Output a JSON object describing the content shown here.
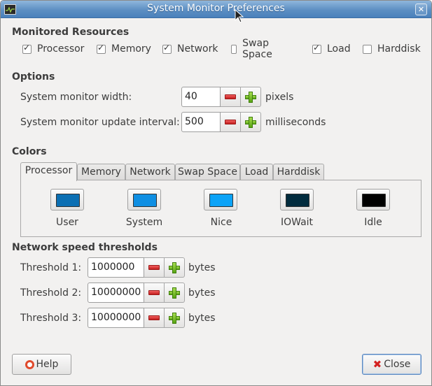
{
  "window": {
    "title": "System Monitor Preferences",
    "close_glyph": "✕"
  },
  "resources": {
    "title": "Monitored Resources",
    "items": [
      {
        "label": "Processor",
        "checked": true
      },
      {
        "label": "Memory",
        "checked": true
      },
      {
        "label": "Network",
        "checked": true
      },
      {
        "label": "Swap Space",
        "checked": false
      },
      {
        "label": "Load",
        "checked": true
      },
      {
        "label": "Harddisk",
        "checked": false
      }
    ]
  },
  "options": {
    "title": "Options",
    "width": {
      "label": "System monitor width:",
      "value": "40",
      "unit": "pixels"
    },
    "interval": {
      "label": "System monitor update interval:",
      "value": "500",
      "unit": "milliseconds"
    }
  },
  "colors": {
    "title": "Colors",
    "tabs": [
      "Processor",
      "Memory",
      "Network",
      "Swap Space",
      "Load",
      "Harddisk"
    ],
    "active_tab": "Processor",
    "swatches": [
      {
        "label": "User",
        "color": "#0b6fb3"
      },
      {
        "label": "System",
        "color": "#0f8fe3"
      },
      {
        "label": "Nice",
        "color": "#0ba3f7"
      },
      {
        "label": "IOWait",
        "color": "#022c3e"
      },
      {
        "label": "Idle",
        "color": "#000000"
      }
    ]
  },
  "network": {
    "title": "Network speed thresholds",
    "thresholds": [
      {
        "label": "Threshold 1:",
        "value": "1000000",
        "unit": "bytes"
      },
      {
        "label": "Threshold 2:",
        "value": "10000000",
        "unit": "bytes"
      },
      {
        "label": "Threshold 3:",
        "value": "10000000",
        "unit": "bytes"
      }
    ]
  },
  "buttons": {
    "help": "Help",
    "close": "Close"
  }
}
